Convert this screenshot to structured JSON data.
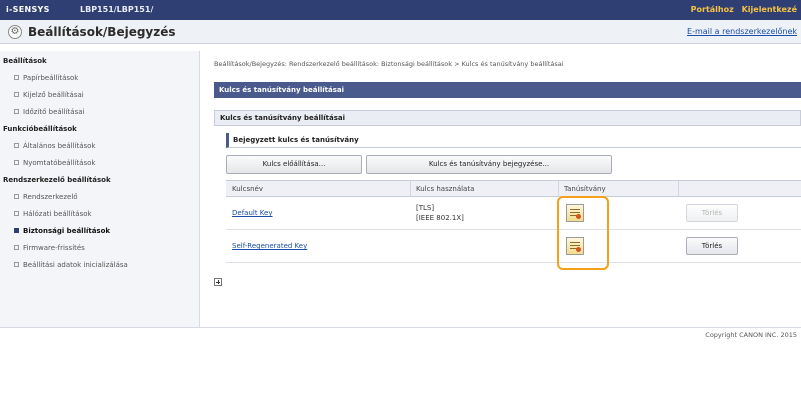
{
  "topbar": {
    "brand": "i-SENSYS",
    "model": "LBP151/LBP151/",
    "link_portal": "Portálhoz",
    "link_logout": "Kijelentkezé"
  },
  "header": {
    "title": "Beállítások/Bejegyzés",
    "email_link": "E-mail a rendszerkezelőnek"
  },
  "sidebar": {
    "items": [
      {
        "label": "Beállítások",
        "type": "head"
      },
      {
        "label": "Papírbeállítások",
        "type": "sub"
      },
      {
        "label": "Kijelző beállításai",
        "type": "sub"
      },
      {
        "label": "Időzítő beállításai",
        "type": "sub"
      },
      {
        "label": "Funkcióbeállítások",
        "type": "head"
      },
      {
        "label": "Általános beállítások",
        "type": "sub"
      },
      {
        "label": "Nyomtatóbeállítások",
        "type": "sub"
      },
      {
        "label": "Rendszerkezelő beállítások",
        "type": "head"
      },
      {
        "label": "Rendszerkezelő",
        "type": "sub"
      },
      {
        "label": "Hálózati beállítások",
        "type": "sub"
      },
      {
        "label": "Biztonsági beállítások",
        "type": "sub",
        "active": true
      },
      {
        "label": "Firmware-frissítés",
        "type": "sub"
      },
      {
        "label": "Beállítási adatok inicializálása",
        "type": "sub"
      }
    ]
  },
  "main": {
    "breadcrumb": "Beállítások/Bejegyzés: Rendszerkezelő beállítások: Biztonsági beállítások > Kulcs és tanúsítvány beállításai",
    "section_title": "Kulcs és tanúsítvány beállításai",
    "sub_title": "Kulcs és tanúsítvány beállításai",
    "subsub_title": "Bejegyzett kulcs és tanúsítvány",
    "btn_generate": "Kulcs előállítása...",
    "btn_register": "Kulcs és tanúsítvány bejegyzése...",
    "table": {
      "headers": [
        "Kulcsnév",
        "Kulcs használata",
        "Tanúsítvány",
        ""
      ],
      "rows": [
        {
          "name": "Default Key",
          "usage_line1": "[TLS]",
          "usage_line2": "[IEEE 802.1X]",
          "action": "Törlés",
          "action_enabled": false
        },
        {
          "name": "Self-Regenerated Key",
          "usage_line1": "",
          "usage_line2": "",
          "action": "Törlés",
          "action_enabled": true
        }
      ]
    }
  },
  "footer": {
    "copyright": "Copyright CANON INC. 2015"
  },
  "colors": {
    "topbar": "#2f3f74",
    "highlight": "#f5a01a",
    "link": "#1a4ea8"
  }
}
